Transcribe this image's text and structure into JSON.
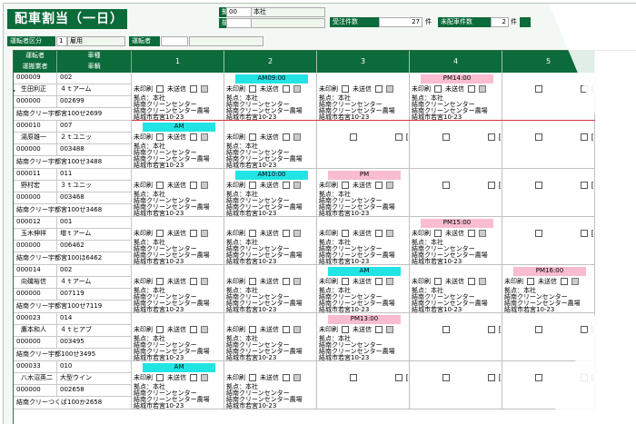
{
  "title": "配車割当（一日）",
  "header": {
    "base_label": "拠点",
    "base_code": "00",
    "base_name": "本社",
    "department_label": "部門",
    "department_code": "",
    "department_name": "",
    "orders_label": "受注件数",
    "orders_count": "27",
    "count_unit": "件",
    "unassigned_label": "未配車件数",
    "unassigned_count": "2"
  },
  "filters": {
    "driver_type_label": "運転者区分",
    "driver_type_code": "1",
    "driver_type_name": "雇用",
    "driver_label": "運転者",
    "driver_code": "",
    "driver_name": ""
  },
  "grid": {
    "col_headers": {
      "driver": "運転者",
      "vehicle_type": "車種",
      "operator": "運搬業者",
      "vehicle": "車輌"
    },
    "slots": [
      "1",
      "2",
      "3",
      "4",
      "5"
    ],
    "row_marker": "▶",
    "labels": {
      "unprinted": "未印刷",
      "unsent": "未送信"
    },
    "rows": [
      {
        "driver_code": "000009",
        "vehicle_code": "002",
        "driver_name": "生田利正",
        "vehicle_type": "４ｔアーム",
        "operator_code": "000000",
        "vehicle_no": "002699",
        "plate": "結南クリー宇都宮100せ2699",
        "time_bars": [
          {
            "slot": 1,
            "label": "AM09:00",
            "color": "cyan"
          },
          {
            "slot": 3,
            "label": "PM14:00",
            "color": "pink"
          }
        ],
        "cards": [
          {
            "slot": 0,
            "lines": [
              "拠点：本社",
              "結南クリーンセンター",
              "結南クリーンセンター農場",
              "結城市若宮10-23"
            ]
          },
          {
            "slot": 1,
            "lines": [
              "拠点：本社",
              "結南クリーンセンター",
              "結南クリーンセンター農場",
              "結城市若宮10-23"
            ]
          },
          {
            "slot": 2,
            "lines": [
              "拠点：本社",
              "結南クリーンセンター",
              "結南クリーンセンター農場",
              "結城市若宮10-23"
            ]
          },
          {
            "slot": 3,
            "lines": [
              "拠点：本社",
              "結南クリーンセンター",
              "結南クリーンセンター農場",
              "結城市若宮10-23"
            ]
          }
        ]
      },
      {
        "driver_code": "000010",
        "vehicle_code": "007",
        "driver_name": "湯原雄一",
        "vehicle_type": "２ｔユニッ",
        "operator_code": "000000",
        "vehicle_no": "003488",
        "plate": "結南クリー宇都宮100せ3488",
        "time_bars": [
          {
            "slot": 0,
            "label": "AM",
            "color": "cyan"
          }
        ],
        "cards": [
          {
            "slot": 0,
            "lines": [
              "拠点：本社",
              "結南クリーンセンター",
              "結南クリーンセンター農場",
              "結城市若宮10-23"
            ]
          },
          {
            "slot": 1,
            "lines": [
              "拠点：本社",
              "結南クリーンセンター",
              "結南クリーンセンター農場",
              "結城市若宮10-23"
            ]
          }
        ]
      },
      {
        "driver_code": "000011",
        "vehicle_code": "011",
        "driver_name": "野村宏",
        "vehicle_type": "３ｔユニッ",
        "operator_code": "000000",
        "vehicle_no": "003468",
        "plate": "結南クリー宇都宮100せ3468",
        "time_bars": [
          {
            "slot": 1,
            "label": "AM10:00",
            "color": "cyan"
          },
          {
            "slot": 2,
            "label": "PM",
            "color": "pink"
          }
        ],
        "cards": [
          {
            "slot": 0,
            "lines": [
              "拠点：本社",
              "結南クリーンセンター",
              "結南クリーンセンター農場",
              "結城市若宮10-23"
            ]
          },
          {
            "slot": 1,
            "lines": [
              "拠点：本社",
              "結南クリーンセンター",
              "結南クリーンセンター農場",
              "結城市若宮10-23"
            ]
          },
          {
            "slot": 2,
            "lines": [
              "拠点：本社",
              "結南クリーンセンター",
              "結南クリーンセンター農場",
              "結城市若宮10-23"
            ]
          }
        ]
      },
      {
        "driver_code": "000012",
        "vehicle_code": "001",
        "driver_name": "玉木伸祥",
        "vehicle_type": "増ｔアーム",
        "operator_code": "000000",
        "vehicle_no": "006462",
        "plate": "結南クリー宇都宮100ほ6462",
        "time_bars": [
          {
            "slot": 3,
            "label": "PM15:00",
            "color": "pink"
          }
        ],
        "cards": [
          {
            "slot": 0,
            "lines": [
              "拠点：本社",
              "結南クリーンセンター",
              "結南クリーンセンター農場",
              "結城市若宮10-23"
            ]
          },
          {
            "slot": 1,
            "lines": [
              "拠点：本社",
              "結南クリーンセンター",
              "結南クリーンセンター農場",
              "結城市若宮10-23"
            ]
          },
          {
            "slot": 2,
            "lines": [
              "拠点：本社",
              "結南クリーンセンター",
              "結南クリーンセンター農場",
              "結城市若宮10-23"
            ]
          },
          {
            "slot": 3,
            "lines": [
              "拠点：本社",
              "結南クリーンセンター",
              "結南クリーンセンター農場",
              "結城市若宮10-23"
            ]
          }
        ]
      },
      {
        "driver_code": "000014",
        "vehicle_code": "002",
        "driver_name": "向磯裕信",
        "vehicle_type": "４ｔアーム",
        "operator_code": "000000",
        "vehicle_no": "007119",
        "plate": "結南クリー宇都宮100せ7119",
        "time_bars": [
          {
            "slot": 2,
            "label": "AM",
            "color": "cyan"
          },
          {
            "slot": 4,
            "label": "PM16:00",
            "color": "pink"
          }
        ],
        "cards": [
          {
            "slot": 0,
            "lines": [
              "拠点：本社",
              "結南クリーンセンター",
              "結南クリーンセンター農場",
              "結城市若宮10-23"
            ]
          },
          {
            "slot": 1,
            "lines": [
              "拠点：本社",
              "結南クリーンセンター",
              "結南クリーンセンター農場",
              "結城市若宮10-23"
            ]
          },
          {
            "slot": 2,
            "lines": [
              "拠点：本社",
              "結南クリーンセンター",
              "結南クリーンセンター農場",
              "結城市若宮10-23"
            ]
          },
          {
            "slot": 3,
            "lines": [
              "拠点：本社",
              "結南クリーンセンター",
              "結南クリーンセンター農場",
              "結城市若宮10-23"
            ]
          },
          {
            "slot": 4,
            "lines": [
              "拠点：本社",
              "結南クリーンセンター",
              "結南クリーンセンター農場",
              "結城市若宮10-23"
            ]
          }
        ]
      },
      {
        "driver_code": "000023",
        "vehicle_code": "014",
        "driver_name": "鷹本和人",
        "vehicle_type": "４ｔヒアブ",
        "operator_code": "000000",
        "vehicle_no": "003495",
        "plate": "結南クリー宇都100せ3495",
        "time_bars": [
          {
            "slot": 2,
            "label": "PM13:00",
            "color": "pink"
          }
        ],
        "cards": [
          {
            "slot": 0,
            "lines": [
              "拠点：本社",
              "結南クリーンセンター",
              "結南クリーンセンター農場",
              "結城市若宮10-23"
            ]
          },
          {
            "slot": 1,
            "lines": [
              "拠点：本社",
              "結南クリーンセンター",
              "結南クリーンセンター農場",
              "結城市若宮10-23"
            ]
          },
          {
            "slot": 2,
            "lines": [
              "拠点：本社",
              "結南クリーンセンター",
              "結南クリーンセンター農場",
              "結城市若宮10-23"
            ]
          }
        ]
      },
      {
        "driver_code": "000033",
        "vehicle_code": "010",
        "driver_name": "八木沼英二",
        "vehicle_type": "大型ウイン",
        "operator_code": "000000",
        "vehicle_no": "002658",
        "plate": "結南クリーつくば100か2658",
        "time_bars": [
          {
            "slot": 0,
            "label": "AM",
            "color": "cyan"
          }
        ],
        "cards": [
          {
            "slot": 0,
            "lines": [
              "拠点：本社",
              "結南クリーンセンター",
              "結南クリーンセンター農場",
              "結城市若宮10-23"
            ]
          },
          {
            "slot": 1,
            "lines": [
              "拠点：本社",
              "結南クリーンセンター",
              "結南クリーンセンター農場",
              "結城市若宮10-23"
            ]
          }
        ]
      }
    ]
  }
}
